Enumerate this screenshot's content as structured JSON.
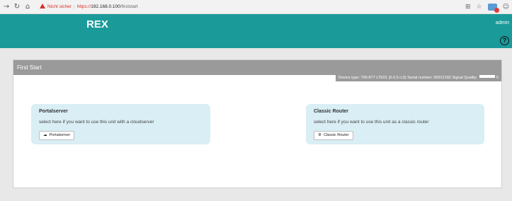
{
  "browser": {
    "warning_text": "Nicht sicher",
    "separator": "|",
    "url_protocol": "https://",
    "url_host": "192.168.0.100",
    "url_path": "/firststart",
    "icons": [
      "back-arrow-icon",
      "reload-icon",
      "home-icon",
      "translate-icon",
      "star-icon",
      "extension-icon",
      "profile-icon"
    ]
  },
  "header": {
    "logo": "REX",
    "user": "admin",
    "help_symbol": "?"
  },
  "panel": {
    "title": "First Start",
    "device_info": "Device type: 700-877 LTE01 (6.0.5 rc3)   Serial number: 50012182   Signal Quality:",
    "signal_value": "0"
  },
  "cards": {
    "portal": {
      "title": "Portalserver",
      "description": "select here if you want to use this unit with a cloudserver",
      "button_label": "Portalserver",
      "button_icon": "cloud-icon"
    },
    "router": {
      "title": "Classic Router",
      "description": "select here if you want to use this unit as a classic router",
      "button_label": "Classic Router",
      "button_icon": "cogs-icon"
    }
  },
  "colors": {
    "header_bg": "#1b9a9a",
    "panel_heading_bg": "#9a9a9a",
    "card_bg": "#d9eef5",
    "warning": "#d93025"
  }
}
